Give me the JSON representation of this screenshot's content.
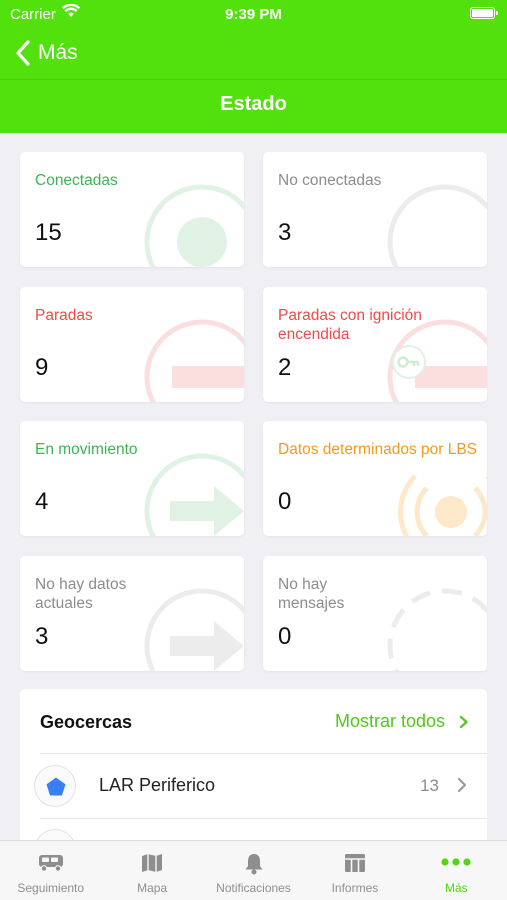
{
  "status_bar": {
    "carrier": "Carrier",
    "time": "9:39 PM"
  },
  "nav": {
    "back_label": "Más",
    "title": "Estado"
  },
  "cards": [
    {
      "label": "Conectadas",
      "value": "15",
      "color": "#3bb552"
    },
    {
      "label": "No conectadas",
      "value": "3",
      "color": "#8c8c8c"
    },
    {
      "label": "Paradas",
      "value": "9",
      "color": "#f04a4a"
    },
    {
      "label": "Paradas con ignición encendida",
      "value": "2",
      "color": "#f04a4a"
    },
    {
      "label": "En movimiento",
      "value": "4",
      "color": "#3bb552"
    },
    {
      "label": "Datos determinados por LBS",
      "value": "0",
      "color": "#f39a1d"
    },
    {
      "label": "No hay datos actuales",
      "value": "3",
      "color": "#8c8c8c"
    },
    {
      "label": "No hay mensajes",
      "value": "0",
      "color": "#8c8c8c"
    }
  ],
  "geofences": {
    "title": "Geocercas",
    "show_all": "Mostrar todos",
    "items": [
      {
        "name": "LAR Periferico",
        "count": "13",
        "icon": "pentagon-icon",
        "color": "#3a7ef5"
      }
    ]
  },
  "tabbar": {
    "tabs": [
      {
        "label": "Seguimiento",
        "icon": "truck-icon",
        "active": false
      },
      {
        "label": "Mapa",
        "icon": "map-icon",
        "active": false
      },
      {
        "label": "Notificaciones",
        "icon": "bell-icon",
        "active": false
      },
      {
        "label": "Informes",
        "icon": "table-icon",
        "active": false
      },
      {
        "label": "Más",
        "icon": "more-dots-icon",
        "active": true
      }
    ],
    "active_color": "#52d610",
    "inactive_color": "#8e8e8e"
  },
  "colors": {
    "brand": "#52e10c",
    "background": "#efeff4"
  }
}
